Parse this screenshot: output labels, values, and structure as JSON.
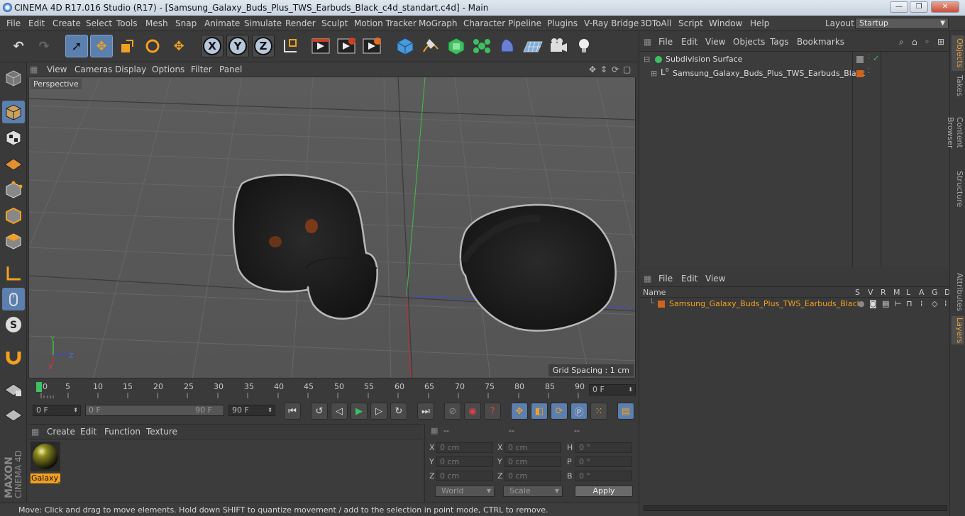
{
  "window": {
    "title": "CINEMA 4D R17.016 Studio (R17) - [Samsung_Galaxy_Buds_Plus_TWS_Earbuds_Black_c4d_standart.c4d] - Main",
    "minimize": "—",
    "maximize": "❐",
    "close": "✕"
  },
  "menu": [
    "File",
    "Edit",
    "Create",
    "Select",
    "Tools",
    "Mesh",
    "Snap",
    "Animate",
    "Simulate",
    "Render",
    "Sculpt",
    "Motion Tracker",
    "MoGraph",
    "Character",
    "Pipeline",
    "Plugins",
    "V-Ray Bridge",
    "3DToAll",
    "Script",
    "Window",
    "Help"
  ],
  "layout": {
    "label": "Layout:",
    "value": "Startup"
  },
  "toolbar": {
    "axis_x": "X",
    "axis_y": "Y",
    "axis_z": "Z"
  },
  "viewport": {
    "menu": [
      "View",
      "Cameras",
      "Display",
      "Options",
      "Filter",
      "Panel"
    ],
    "label": "Perspective",
    "grid_spacing": "Grid Spacing : 1 cm",
    "gizmo": {
      "y": "Y",
      "z": "Z",
      "x": "X"
    }
  },
  "timeline": {
    "ticks": [
      "0",
      "5",
      "10",
      "15",
      "20",
      "25",
      "30",
      "35",
      "40",
      "45",
      "50",
      "55",
      "60",
      "65",
      "70",
      "75",
      "80",
      "85",
      "90"
    ],
    "current_frame": "0 F",
    "start_field": "0 F",
    "range_start": "0 F",
    "range_end": "90 F",
    "end_field": "90 F"
  },
  "materials": {
    "menu": [
      "Create",
      "Edit",
      "Function",
      "Texture"
    ],
    "item_label": "Galaxy_B"
  },
  "coordinates": {
    "headers": [
      "--",
      "--",
      "--"
    ],
    "rows": [
      {
        "l1": "X",
        "v1": "0 cm",
        "l2": "X",
        "v2": "0 cm",
        "l3": "H",
        "v3": "0 °"
      },
      {
        "l1": "Y",
        "v1": "0 cm",
        "l2": "Y",
        "v2": "0 cm",
        "l3": "P",
        "v3": "0 °"
      },
      {
        "l1": "Z",
        "v1": "0 cm",
        "l2": "Z",
        "v2": "0 cm",
        "l3": "B",
        "v3": "0 °"
      }
    ],
    "world": "World",
    "scale": "Scale",
    "apply": "Apply"
  },
  "status": "Move: Click and drag to move elements. Hold down SHIFT to quantize movement / add to the selection in point mode, CTRL to remove.",
  "objects": {
    "menu": [
      "File",
      "Edit",
      "View",
      "Objects",
      "Tags",
      "Bookmarks"
    ],
    "items": [
      {
        "name": "Subdivision Surface"
      },
      {
        "name": "Samsung_Galaxy_Buds_Plus_TWS_Earbuds_Black"
      }
    ]
  },
  "layers": {
    "menu": [
      "File",
      "Edit",
      "View"
    ],
    "columns": [
      "Name",
      "S",
      "V",
      "R",
      "M",
      "L",
      "A",
      "G",
      "D"
    ],
    "items": [
      {
        "name": "Samsung_Galaxy_Buds_Plus_TWS_Earbuds_Black"
      }
    ]
  },
  "right_tabs": [
    "Objects",
    "Takes",
    "Content Browser",
    "Structure",
    "Attributes",
    "Layers"
  ],
  "brand": {
    "maxon": "MAXON",
    "product": "CINEMA 4D"
  },
  "colors": {
    "accent_orange": "#e8902a",
    "selected_blue": "#5b7fae",
    "layer_color": "#d0641e"
  }
}
